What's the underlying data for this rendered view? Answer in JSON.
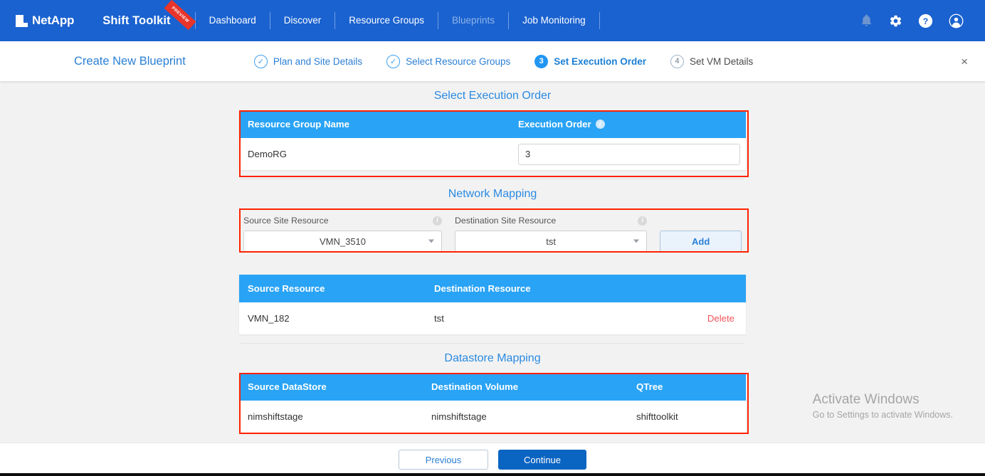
{
  "topnav": {
    "logo_text": "NetApp",
    "brand": "Shift Toolkit",
    "ribbon": "PREVIEW",
    "items": [
      {
        "label": "Dashboard",
        "active": false
      },
      {
        "label": "Discover",
        "active": false
      },
      {
        "label": "Resource Groups",
        "active": false
      },
      {
        "label": "Blueprints",
        "active": true
      },
      {
        "label": "Job Monitoring",
        "active": false
      }
    ],
    "icons": [
      "bell-icon",
      "gear-icon",
      "help-icon",
      "user-avatar-icon"
    ]
  },
  "stepbar": {
    "title": "Create New Blueprint",
    "steps": [
      {
        "marker": "✓",
        "label": "Plan and Site Details",
        "state": "done"
      },
      {
        "marker": "✓",
        "label": "Select Resource Groups",
        "state": "done"
      },
      {
        "marker": "3",
        "label": "Set Execution Order",
        "state": "active"
      },
      {
        "marker": "4",
        "label": "Set VM Details",
        "state": "todo"
      }
    ],
    "close": "×"
  },
  "execution_order": {
    "section_title": "Select Execution Order",
    "headers": [
      "Resource Group Name",
      "Execution Order"
    ],
    "info_tooltip": "i",
    "row": {
      "group_name": "DemoRG",
      "order_value": "3"
    }
  },
  "network_mapping": {
    "section_title": "Network Mapping",
    "source_label": "Source Site Resource",
    "destination_label": "Destination Site Resource",
    "source_value": "VMN_3510",
    "destination_value": "tst",
    "add_label": "Add",
    "table_headers": [
      "Source Resource",
      "Destination Resource"
    ],
    "rows": [
      {
        "source": "VMN_182",
        "destination": "tst",
        "action": "Delete"
      }
    ]
  },
  "datastore_mapping": {
    "section_title": "Datastore Mapping",
    "headers": [
      "Source DataStore",
      "Destination Volume",
      "QTree"
    ],
    "rows": [
      {
        "source": "nimshiftstage",
        "volume": "nimshiftstage",
        "qtree": "shifttoolkit"
      }
    ]
  },
  "footer": {
    "previous_label": "Previous",
    "continue_label": "Continue"
  },
  "watermark": {
    "line1": "Activate Windows",
    "line2": "Go to Settings to activate Windows."
  },
  "colors": {
    "nav_blue": "#1a62d0",
    "table_header_blue": "#29a3f5",
    "accent_blue": "#2b7fd4",
    "highlight_red": "#ff2200",
    "delete_red": "#f2545b",
    "continue_blue": "#0a64c2"
  }
}
